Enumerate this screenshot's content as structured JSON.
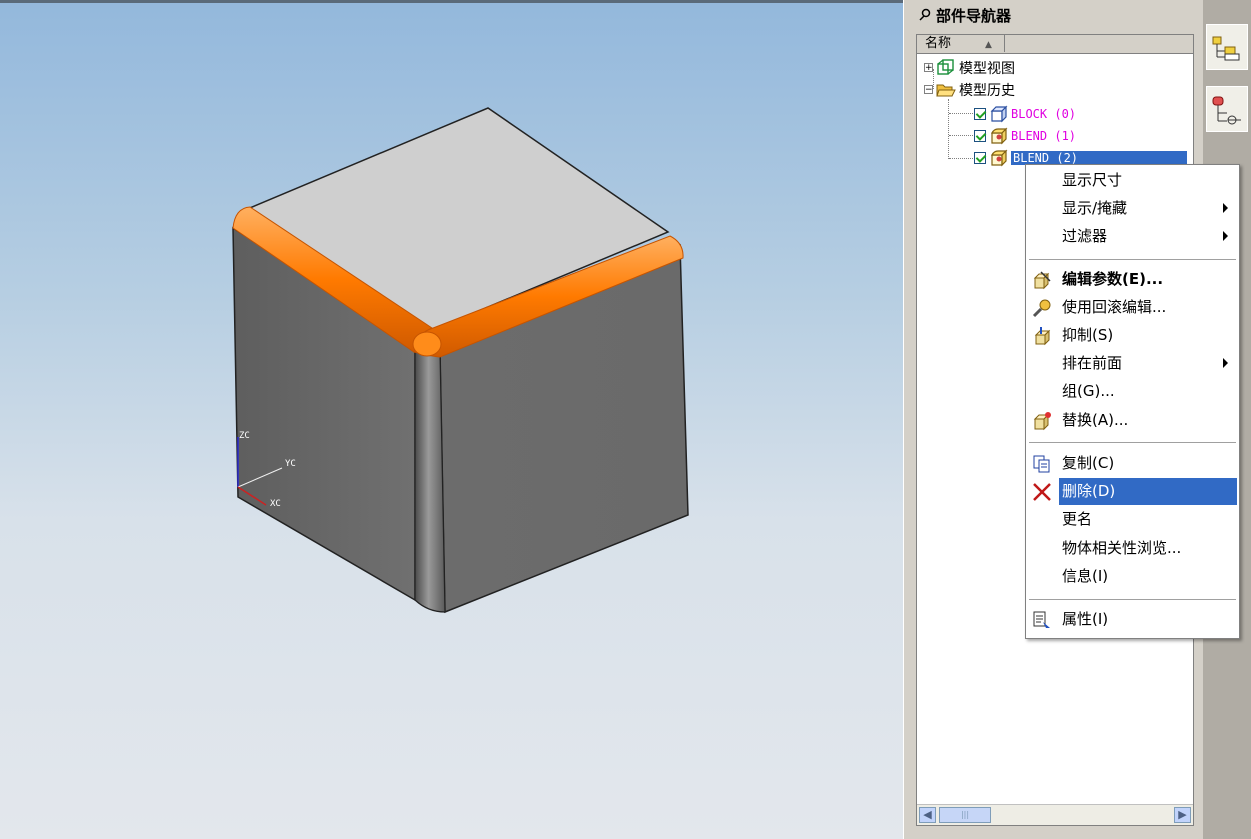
{
  "navigator": {
    "title": "部件导航器",
    "column_name": "名称",
    "tree": {
      "model_views": "模型视图",
      "model_history": "模型历史",
      "features": [
        "BLOCK (0)",
        "BLEND (1)",
        "BLEND (2)"
      ],
      "selected_feature": "BLEND (2)"
    }
  },
  "viewport": {
    "axis_labels": {
      "z": "ZC",
      "y": "YC",
      "x": "XC"
    },
    "colors": {
      "blend_highlight": "#ff7a00",
      "body_face": "#6e6e6e",
      "top_face": "#cfcfcf"
    }
  },
  "context_menu": {
    "items": [
      {
        "label": "显示尺寸",
        "icon": "",
        "submenu": false
      },
      {
        "label": "显示/掩藏",
        "icon": "",
        "submenu": true
      },
      {
        "label": "过滤器",
        "icon": "",
        "submenu": true
      },
      {
        "label": "编辑参数(E)...",
        "icon": "edit-parameters-icon",
        "submenu": false,
        "bold": true
      },
      {
        "label": "使用回滚编辑...",
        "icon": "rollback-edit-icon",
        "submenu": false
      },
      {
        "label": "抑制(S)",
        "icon": "suppress-icon",
        "submenu": false
      },
      {
        "label": "排在前面",
        "icon": "",
        "submenu": true
      },
      {
        "label": "组(G)...",
        "icon": "",
        "submenu": false
      },
      {
        "label": "替换(A)...",
        "icon": "replace-icon",
        "submenu": false
      },
      {
        "label": "复制(C)",
        "icon": "copy-icon",
        "submenu": false
      },
      {
        "label": "删除(D)",
        "icon": "delete-icon",
        "submenu": false,
        "highlighted": true
      },
      {
        "label": "更名",
        "icon": "",
        "submenu": false
      },
      {
        "label": "物体相关性浏览...",
        "icon": "",
        "submenu": false
      },
      {
        "label": "信息(I)",
        "icon": "",
        "submenu": false
      },
      {
        "label": "属性(I)",
        "icon": "properties-icon",
        "submenu": false
      }
    ]
  },
  "resource_bar": {
    "buttons": [
      "part-navigator-icon",
      "assembly-navigator-icon"
    ]
  }
}
